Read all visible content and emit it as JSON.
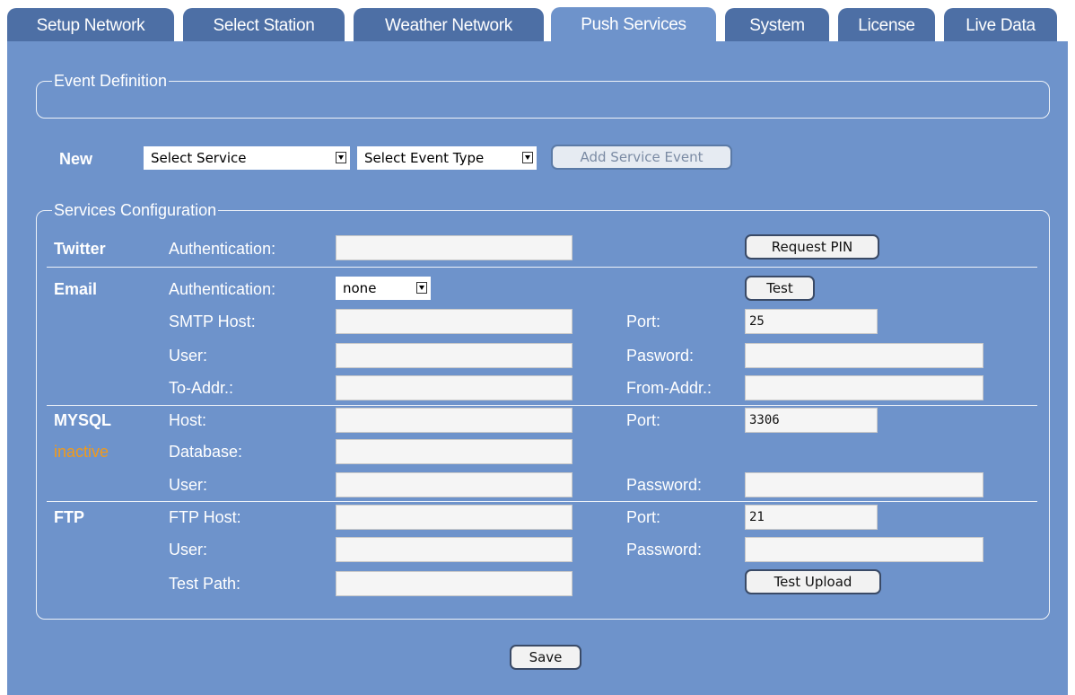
{
  "tabs": [
    "Setup Network",
    "Select Station",
    "Weather Network",
    "Push Services",
    "System",
    "License",
    "Live Data"
  ],
  "event_definition": {
    "legend": "Event Definition"
  },
  "new_event": {
    "label": "New",
    "service_select": "Select Service",
    "event_type_select": "Select Event Type",
    "add_button": "Add Service Event"
  },
  "services": {
    "legend": "Services Configuration",
    "twitter": {
      "title": "Twitter",
      "auth_label": "Authentication:",
      "auth_value": "",
      "request_pin": "Request PIN"
    },
    "email": {
      "title": "Email",
      "auth_label": "Authentication:",
      "auth_value": "none",
      "test": "Test",
      "smtp_host_label": "SMTP Host:",
      "smtp_host": "",
      "port_label": "Port:",
      "port": "25",
      "user_label": "User:",
      "user": "",
      "password_label": "Pasword:",
      "password": "",
      "to_label": "To-Addr.:",
      "to": "",
      "from_label": "From-Addr.:",
      "from": ""
    },
    "mysql": {
      "title": "MYSQL",
      "status": "inactive",
      "host_label": "Host:",
      "host": "",
      "port_label": "Port:",
      "port": "3306",
      "database_label": "Database:",
      "database": "",
      "user_label": "User:",
      "user": "",
      "password_label": "Password:",
      "password": ""
    },
    "ftp": {
      "title": "FTP",
      "host_label": "FTP Host:",
      "host": "",
      "port_label": "Port:",
      "port": "21",
      "user_label": "User:",
      "user": "",
      "password_label": "Password:",
      "password": "",
      "test_path_label": "Test Path:",
      "test_path": "",
      "test_upload": "Test Upload"
    }
  },
  "save": "Save",
  "colors": {
    "panel": "#6e93cb",
    "tab": "#4d6fa5",
    "inactive": "#f29a19"
  }
}
